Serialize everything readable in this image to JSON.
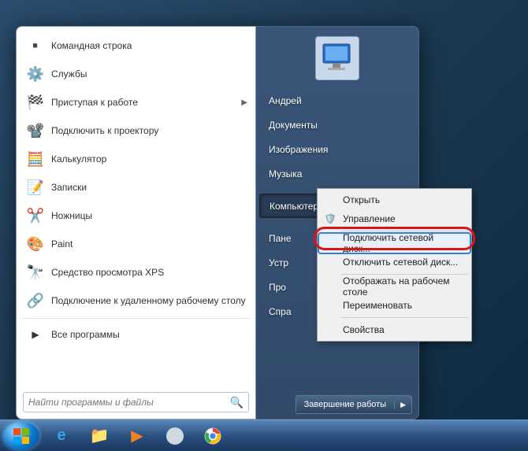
{
  "programs": [
    {
      "icon": "💻",
      "label": "Командная строка",
      "arrow": false
    },
    {
      "icon": "⚙️",
      "label": "Службы",
      "arrow": false
    },
    {
      "icon": "🏁",
      "label": "Приступая к работе",
      "arrow": true
    },
    {
      "icon": "📽️",
      "label": "Подключить к проектору",
      "arrow": false
    },
    {
      "icon": "🧮",
      "label": "Калькулятор",
      "arrow": false
    },
    {
      "icon": "📝",
      "label": "Записки",
      "arrow": false
    },
    {
      "icon": "✂️",
      "label": "Ножницы",
      "arrow": false
    },
    {
      "icon": "🎨",
      "label": "Paint",
      "arrow": false
    },
    {
      "icon": "🔭",
      "label": "Средство просмотра XPS",
      "arrow": false
    },
    {
      "icon": "🔗",
      "label": "Подключение к удаленному рабочему столу",
      "arrow": false
    }
  ],
  "all_programs": "Все программы",
  "search_placeholder": "Найти программы и файлы",
  "right_items": [
    "Андрей",
    "Документы",
    "Изображения",
    "Музыка",
    "",
    "Компьютер",
    "",
    "Панель управления",
    "Устройства и принтеры",
    "Программы по умолчанию",
    "Справка и поддержка"
  ],
  "right_items_visible": {
    "0": "Андрей",
    "1": "Документы",
    "2": "Изображения",
    "3": "Музыка",
    "5": "Компьютер",
    "7": "Пане",
    "8": "Устр",
    "9": "Про",
    "10": "Спра"
  },
  "shutdown": {
    "label": "Завершение работы"
  },
  "context_menu": [
    {
      "label": "Открыть"
    },
    {
      "label": "Управление",
      "icon": "🛡️"
    },
    {
      "sep": true
    },
    {
      "label": "Подключить сетевой диск...",
      "highlighted": true
    },
    {
      "label": "Отключить сетевой диск..."
    },
    {
      "sep": true
    },
    {
      "label": "Отображать на рабочем столе"
    },
    {
      "label": "Переименовать"
    },
    {
      "sep": true
    },
    {
      "label": "Свойства"
    }
  ],
  "taskbar_icons": [
    "start",
    "ie",
    "explorer",
    "wmp",
    "moon",
    "chrome"
  ]
}
